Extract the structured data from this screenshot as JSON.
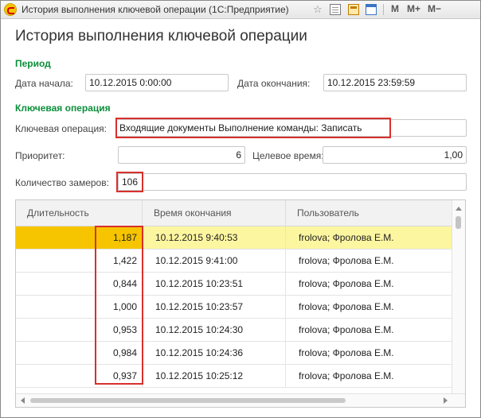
{
  "window": {
    "title": "История выполнения ключевой операции  (1С:Предприятие)",
    "toolbar": {
      "m_label": "M",
      "m_plus_label": "M+",
      "m_minus_label": "M−",
      "icons": [
        "star-icon",
        "document-icon",
        "calculator-icon",
        "calendar-icon"
      ]
    }
  },
  "form": {
    "title": "История выполнения ключевой операции",
    "period": {
      "section_title": "Период",
      "start_label": "Дата начала:",
      "start_value": "10.12.2015  0:00:00",
      "end_label": "Дата окончания:",
      "end_value": "10.12.2015 23:59:59"
    },
    "key_operation": {
      "section_title": "Ключевая операция",
      "operation_label": "Ключевая операция:",
      "operation_value": "Входящие документы Выполнение команды: Записать",
      "priority_label": "Приоритет:",
      "priority_value": "6",
      "target_time_label": "Целевое время:",
      "target_time_value": "1,00",
      "measurements_label": "Количество замеров:",
      "measurements_value": "106"
    }
  },
  "table": {
    "columns": [
      "Длительность",
      "Время окончания",
      "Пользователь"
    ],
    "rows": [
      {
        "duration": "1,187",
        "end_time": "10.12.2015 9:40:53",
        "user": "frolova;  Фролова Е.М.",
        "selected": true
      },
      {
        "duration": "1,422",
        "end_time": "10.12.2015 9:41:00",
        "user": "frolova;  Фролова Е.М."
      },
      {
        "duration": "0,844",
        "end_time": "10.12.2015 10:23:51",
        "user": "frolova;  Фролова Е.М."
      },
      {
        "duration": "1,000",
        "end_time": "10.12.2015 10:23:57",
        "user": "frolova;  Фролова Е.М."
      },
      {
        "duration": "0,953",
        "end_time": "10.12.2015 10:24:30",
        "user": "frolova;  Фролова Е.М."
      },
      {
        "duration": "0,984",
        "end_time": "10.12.2015 10:24:36",
        "user": "frolova;  Фролова Е.М."
      },
      {
        "duration": "0,937",
        "end_time": "10.12.2015 10:25:12",
        "user": "frolova;  Фролова Е.М."
      }
    ]
  },
  "colors": {
    "section_title": "#0b8f3a",
    "highlight_box": "#d9302c",
    "selected_row": "#fdf6a0",
    "selected_cell": "#f6c500"
  }
}
